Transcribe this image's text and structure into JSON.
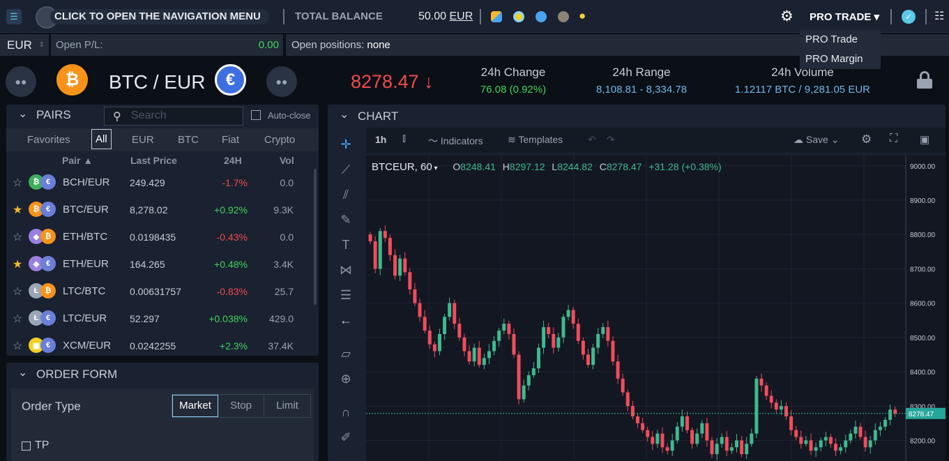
{
  "topbar": {
    "menu_text": "CLICK TO OPEN THE NAVIGATION MENU",
    "total_balance_label": "TOTAL BALANCE",
    "balance_value": "50.00",
    "balance_currency": "EUR",
    "mode_label": "PRO TRADE",
    "mode_options": [
      "PRO Trade",
      "PRO Margin"
    ]
  },
  "subbar": {
    "currency": "EUR",
    "open_pl_label": "Open P/L:",
    "open_pl_value": "0.00",
    "open_positions_label": "Open positions:",
    "open_positions_value": "none"
  },
  "ticker": {
    "pair": "BTC / EUR",
    "price": "8278.47",
    "arrow": "↓",
    "change_label": "24h Change",
    "change_value": "76.08 (0.92%)",
    "range_label": "24h Range",
    "range_value": "8,108.81 - 8,334.78",
    "volume_label": "24h Volume",
    "volume_value": "1.12117 BTC / 9,281.05 EUR"
  },
  "pairs": {
    "title": "PAIRS",
    "search_placeholder": "Search",
    "autoclose_label": "Auto-close",
    "tabs": [
      "Favorites",
      "All",
      "EUR",
      "BTC",
      "Fiat",
      "Crypto"
    ],
    "active_tab": "All",
    "columns": [
      "Pair",
      "Last Price",
      "24H",
      "Vol"
    ],
    "rows": [
      {
        "pair": "BCH/EUR",
        "price": "249.429",
        "change": "-1.7%",
        "vol": "0.0",
        "fav": false,
        "dir": "dn",
        "c1": "#3fae5a",
        "c1t": "₿",
        "c2": "#6a7fd8",
        "c2t": "€"
      },
      {
        "pair": "BTC/EUR",
        "price": "8,278.02",
        "change": "+0.92%",
        "vol": "9.3K",
        "fav": true,
        "dir": "up",
        "c1": "#f7931a",
        "c1t": "₿",
        "c2": "#6a7fd8",
        "c2t": "€"
      },
      {
        "pair": "ETH/BTC",
        "price": "0.0198435",
        "change": "-0.43%",
        "vol": "0.0",
        "fav": false,
        "dir": "dn",
        "c1": "#9b7fe0",
        "c1t": "◆",
        "c2": "#f7931a",
        "c2t": "₿"
      },
      {
        "pair": "ETH/EUR",
        "price": "164.265",
        "change": "+0.48%",
        "vol": "3.4K",
        "fav": true,
        "dir": "up",
        "c1": "#9b7fe0",
        "c1t": "◆",
        "c2": "#6a7fd8",
        "c2t": "€"
      },
      {
        "pair": "LTC/BTC",
        "price": "0.00631757",
        "change": "-0.83%",
        "vol": "25.7",
        "fav": false,
        "dir": "dn",
        "c1": "#9aa6b8",
        "c1t": "Ł",
        "c2": "#f7931a",
        "c2t": "₿"
      },
      {
        "pair": "LTC/EUR",
        "price": "52.297",
        "change": "+0.038%",
        "vol": "429.0",
        "fav": false,
        "dir": "up",
        "c1": "#9aa6b8",
        "c1t": "Ł",
        "c2": "#6a7fd8",
        "c2t": "€"
      },
      {
        "pair": "XCM/EUR",
        "price": "0.0242255",
        "change": "+2.3%",
        "vol": "37.4K",
        "fav": false,
        "dir": "up",
        "c1": "#f2d022",
        "c1t": "▣",
        "c2": "#6a7fd8",
        "c2t": "€"
      }
    ]
  },
  "order_form": {
    "title": "ORDER FORM",
    "order_type_label": "Order Type",
    "types": [
      "Market",
      "Stop",
      "Limit"
    ],
    "tp_label": "TP"
  },
  "chart": {
    "panel_title": "CHART",
    "interval": "1h",
    "indicators_label": "Indicators",
    "templates_label": "Templates",
    "save_label": "Save",
    "symbol": "BTCEUR, 60",
    "ohlc": {
      "o": "8248.41",
      "h": "8297.12",
      "l": "8244.82",
      "c": "8278.47",
      "chg": "+31.28 (+0.38%)"
    },
    "last_label": "8278.47"
  },
  "chart_data": {
    "type": "candlestick",
    "ylim": [
      8140,
      9030
    ],
    "y_ticks": [
      9000,
      8900,
      8800,
      8700,
      8600,
      8500,
      8400,
      8300,
      8200
    ],
    "last_price": 8278.47,
    "closes": [
      8780,
      8700,
      8810,
      8790,
      8740,
      8680,
      8730,
      8690,
      8640,
      8600,
      8560,
      8520,
      8480,
      8460,
      8510,
      8560,
      8600,
      8540,
      8500,
      8460,
      8430,
      8470,
      8420,
      8440,
      8460,
      8490,
      8520,
      8540,
      8510,
      8450,
      8320,
      8360,
      8390,
      8410,
      8470,
      8530,
      8510,
      8470,
      8500,
      8560,
      8580,
      8540,
      8490,
      8450,
      8420,
      8470,
      8510,
      8530,
      8490,
      8430,
      8380,
      8340,
      8300,
      8270,
      8250,
      8230,
      8210,
      8190,
      8220,
      8180,
      8170,
      8200,
      8240,
      8270,
      8230,
      8190,
      8220,
      8250,
      8200,
      8160,
      8190,
      8210,
      8170,
      8180,
      8200,
      8160,
      8190,
      8220,
      8380,
      8360,
      8330,
      8310,
      8290,
      8300,
      8270,
      8230,
      8210,
      8190,
      8200,
      8170,
      8180,
      8200,
      8210,
      8190,
      8170,
      8180,
      8200,
      8220,
      8240,
      8210,
      8180,
      8200,
      8230,
      8240,
      8260,
      8290,
      8278
    ]
  }
}
